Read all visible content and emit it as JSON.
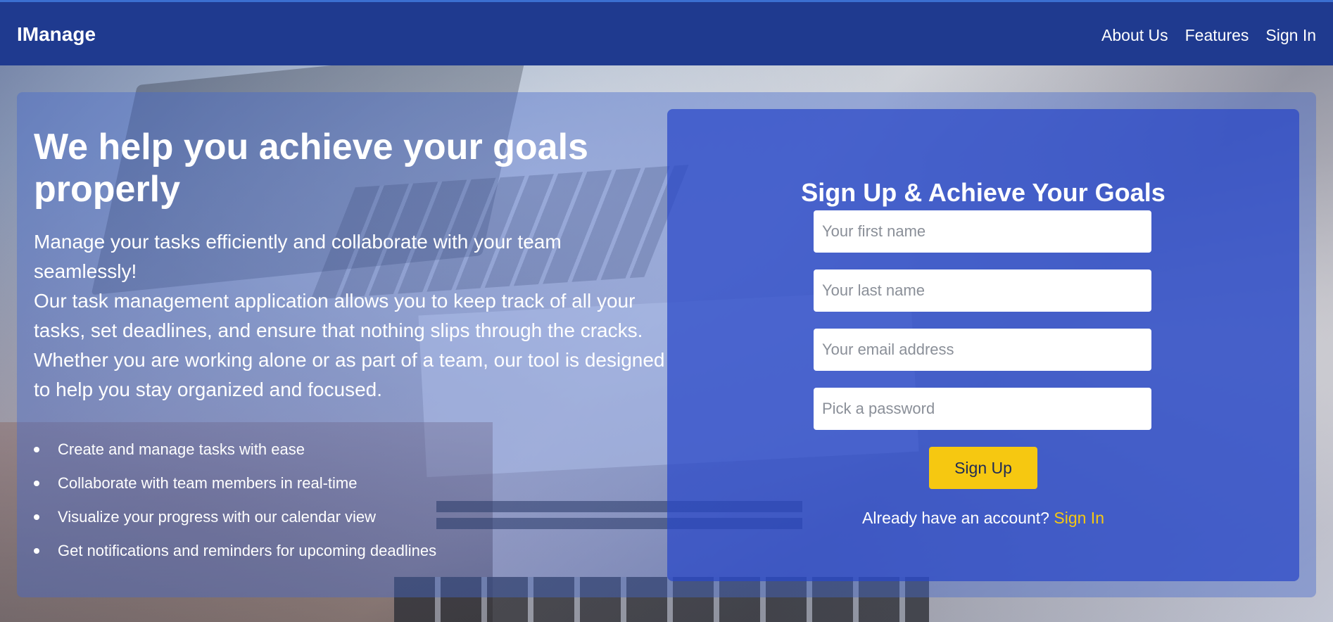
{
  "nav": {
    "brand": "IManage",
    "links": [
      "About Us",
      "Features",
      "Sign In"
    ]
  },
  "hero": {
    "title": "We help you achieve your goals properly",
    "lead_line1": "Manage your tasks efficiently and collaborate with your team seamlessly!",
    "lead_line2": "Our task management application allows you to keep track of all your tasks, set deadlines, and ensure that nothing slips through the cracks. Whether you are working alone or as part of a team, our tool is designed to help you stay organized and focused.",
    "features": [
      "Create and manage tasks with ease",
      "Collaborate with team members in real-time",
      "Visualize your progress with our calendar view",
      "Get notifications and reminders for upcoming deadlines"
    ]
  },
  "signup": {
    "title": "Sign Up & Achieve Your Goals",
    "first_name_placeholder": "Your first name",
    "last_name_placeholder": "Your last name",
    "email_placeholder": "Your email address",
    "password_placeholder": "Pick a password",
    "button_label": "Sign Up",
    "already_text": "Already have an account?",
    "signin_link": "Sign In"
  },
  "colors": {
    "navbar": "#1f3a8f",
    "accent": "#f6c811",
    "card": "#2846c8"
  }
}
